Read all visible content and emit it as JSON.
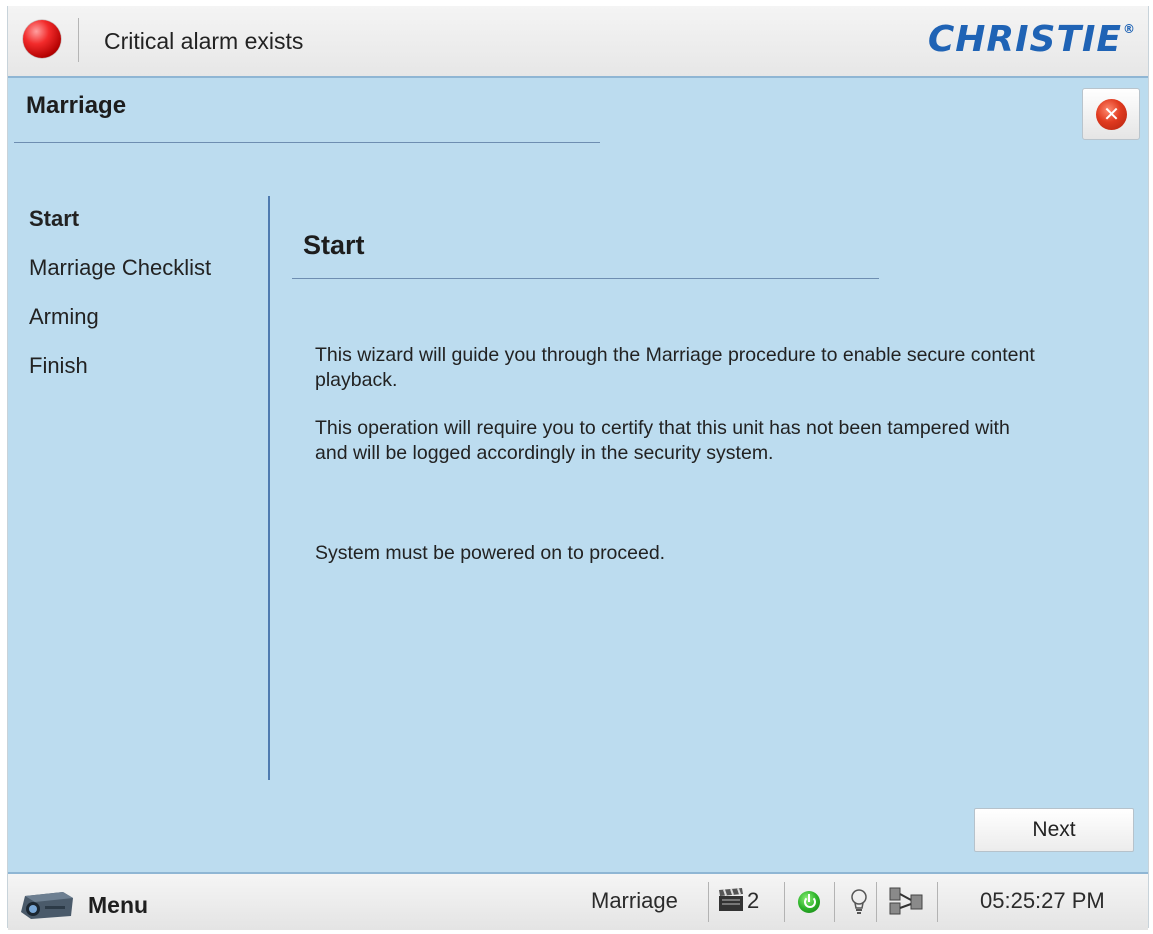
{
  "alarm_bar": {
    "message": "Critical alarm exists",
    "led_color": "#e02020",
    "led_icon": "red-alarm-led",
    "brand_logo": "CHRISTIE",
    "brand_mark": "®",
    "brand_color": "#1f63b5"
  },
  "page": {
    "title": "Marriage",
    "close_icon": "close-icon",
    "close_glyph": "✕"
  },
  "nav": {
    "items": [
      {
        "label": "Start",
        "active": true
      },
      {
        "label": "Marriage Checklist",
        "active": false
      },
      {
        "label": "Arming",
        "active": false
      },
      {
        "label": "Finish",
        "active": false
      }
    ]
  },
  "content": {
    "title": "Start",
    "paragraphs": [
      "This wizard will guide you through the Marriage procedure to enable secure content playback.",
      "This operation will require you to certify that this unit has not been tampered with and will be logged accordingly in the security system.",
      "System must be powered on to proceed."
    ]
  },
  "buttons": {
    "next_label": "Next"
  },
  "status_bar": {
    "menu_label": "Menu",
    "mode": "Marriage",
    "show_count": "2",
    "time": "05:25:27 PM",
    "icons": [
      "projector-icon",
      "clapperboard-icon",
      "power-on-icon",
      "lamp-bulb-icon",
      "network-icon"
    ]
  },
  "colors": {
    "background": "#bcdcef",
    "rule": "#6e8eb1",
    "divider": "#4f7bb0",
    "power_on": "#2db42a"
  }
}
